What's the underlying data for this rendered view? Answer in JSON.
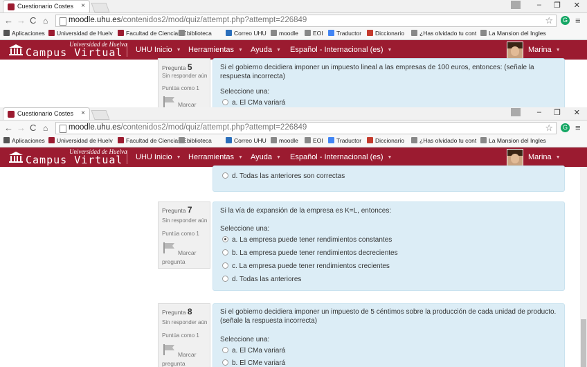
{
  "browser": {
    "tab_title": "Cuestionario Costes",
    "tab_close": "×",
    "url_host": "moodle.uhu.es",
    "url_path": "/contenidos2/mod/quiz/attempt.php?attempt=226849",
    "nav_back": "←",
    "nav_forward": "→",
    "nav_reload": "C",
    "nav_home": "⌂",
    "star": "☆",
    "menu": "≡",
    "window_min": "–",
    "window_max": "❐",
    "window_close": "✕",
    "ext_label": "G",
    "bookmarks": [
      {
        "label": "Aplicaciones",
        "icon": "apps-grid-icon",
        "color": "#555555"
      },
      {
        "label": "Universidad de Huelv",
        "icon": "uhu-crest-icon",
        "color": "#9b1b30"
      },
      {
        "label": "Facultad de Ciencias E",
        "icon": "faculty-icon",
        "color": "#9b1b30"
      },
      {
        "label": "biblioteca",
        "icon": "page-icon",
        "color": "#888888"
      },
      {
        "label": "Correo UHU",
        "icon": "mail-icon",
        "color": "#2a6ebb"
      },
      {
        "label": "moodle",
        "icon": "page-icon",
        "color": "#888888"
      },
      {
        "label": "EOI",
        "icon": "page-icon",
        "color": "#888888"
      },
      {
        "label": "Traductor",
        "icon": "translate-icon",
        "color": "#4285f4"
      },
      {
        "label": "Diccionario",
        "icon": "wr-icon",
        "color": "#c43b2d"
      },
      {
        "label": "¿Has olvidado tu cont",
        "icon": "page-icon",
        "color": "#888888"
      },
      {
        "label": "La Mansion del Ingles",
        "icon": "page-icon",
        "color": "#888888"
      }
    ]
  },
  "site": {
    "logo_top": "Universidad de Huelva",
    "logo_main": "Campus Virtual",
    "menu": [
      "UHU Inicio",
      "Herramientas",
      "Ayuda",
      "Español - Internacional (es)"
    ],
    "user": "Marina",
    "brand_color": "#9b1b30"
  },
  "window1": {
    "question": {
      "label": "Pregunta",
      "number": "5",
      "state": "Sin responder aún",
      "grade": "Puntúa como 1",
      "flag": "Marcar",
      "text": "Si el gobierno decidiera imponer un impuesto lineal a las empresas de 100 euros, entonces: (señale la respuesta incorrecta)",
      "prompt": "Seleccione una:",
      "options": [
        "a. El CMa variará"
      ]
    }
  },
  "window2": {
    "partial_option": "d. Todas las anteriores son correctas",
    "q7": {
      "label": "Pregunta",
      "number": "7",
      "state": "Sin responder aún",
      "grade": "Puntúa como 1",
      "flag": "Marcar",
      "flag2": "pregunta",
      "text": "Si la vía de expansión de la empresa es K=L, entonces:",
      "prompt": "Seleccione una:",
      "options": [
        "a. La empresa puede tener rendimientos constantes",
        "b. La empresa puede tener rendimientos decrecientes",
        "c. La empresa puede tener rendimientos crecientes",
        "d. Todas las anteriores"
      ],
      "selected_index": 0
    },
    "q8": {
      "label": "Pregunta",
      "number": "8",
      "state": "Sin responder aún",
      "grade": "Puntúa como 1",
      "flag": "Marcar",
      "flag2": "pregunta",
      "text": "Si el gobierno decidiera imponer un impuesto de 5 céntimos sobre la producción de cada unidad de producto. (señale la respuesta incorrecta)",
      "prompt": "Seleccione una:",
      "options": [
        "a. El CMa variará",
        "b. El CMe variará"
      ]
    }
  }
}
